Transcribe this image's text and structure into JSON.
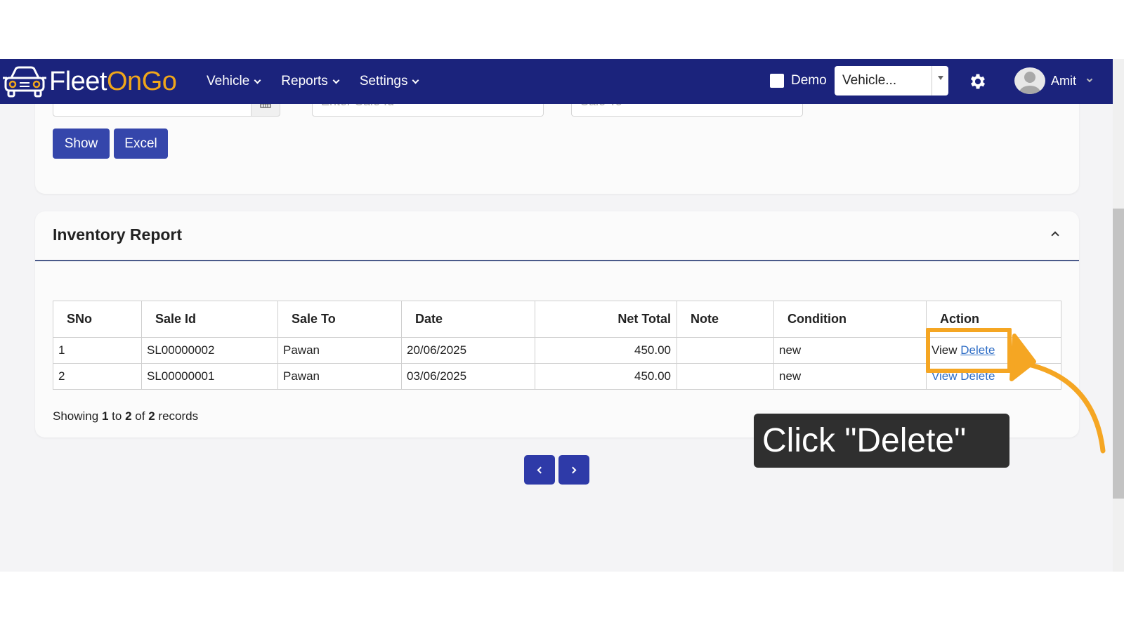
{
  "brand": {
    "name_part1": "Fleet",
    "name_part2": "On",
    "name_part3": "Go"
  },
  "nav": {
    "items": [
      {
        "label": "Vehicle"
      },
      {
        "label": "Reports"
      },
      {
        "label": "Settings"
      }
    ],
    "demo_label": "Demo",
    "vehicle_select_value": "Vehicle...",
    "user_name": "Amit"
  },
  "filters": {
    "sale_id_placeholder": "Enter Sale Id",
    "sale_to_placeholder": "Sale To",
    "show_label": "Show",
    "excel_label": "Excel"
  },
  "report": {
    "title": "Inventory Report",
    "columns": [
      "SNo",
      "Sale Id",
      "Sale To",
      "Date",
      "Net Total",
      "Note",
      "Condition",
      "Action"
    ],
    "rows": [
      {
        "sno": "1",
        "sale_id": "SL00000002",
        "sale_to": "Pawan",
        "date": "20/06/2025",
        "net_total": "450.00",
        "note": "",
        "condition": "new",
        "view": "View",
        "delete": "Delete"
      },
      {
        "sno": "2",
        "sale_id": "SL00000001",
        "sale_to": "Pawan",
        "date": "03/06/2025",
        "net_total": "450.00",
        "note": "",
        "condition": "new",
        "view": "View",
        "delete": "Delete"
      }
    ],
    "showing": {
      "prefix": "Showing",
      "from": "1",
      "to_word": "to",
      "to": "2",
      "of_word": "of",
      "total": "2",
      "suffix": "records"
    }
  },
  "tutorial": {
    "callout_text": "Click \"Delete\""
  },
  "colors": {
    "navbar": "#1b237c",
    "brand_accent": "#f0a61a",
    "button": "#3546ab",
    "highlight": "#f5a623",
    "link": "#2f6ec6"
  },
  "icons": [
    "car-icon",
    "chevron-down-icon",
    "calendar-icon",
    "gear-icon",
    "avatar",
    "chevron-up-icon",
    "chevron-left-icon",
    "chevron-right-icon",
    "arrow-icon"
  ]
}
